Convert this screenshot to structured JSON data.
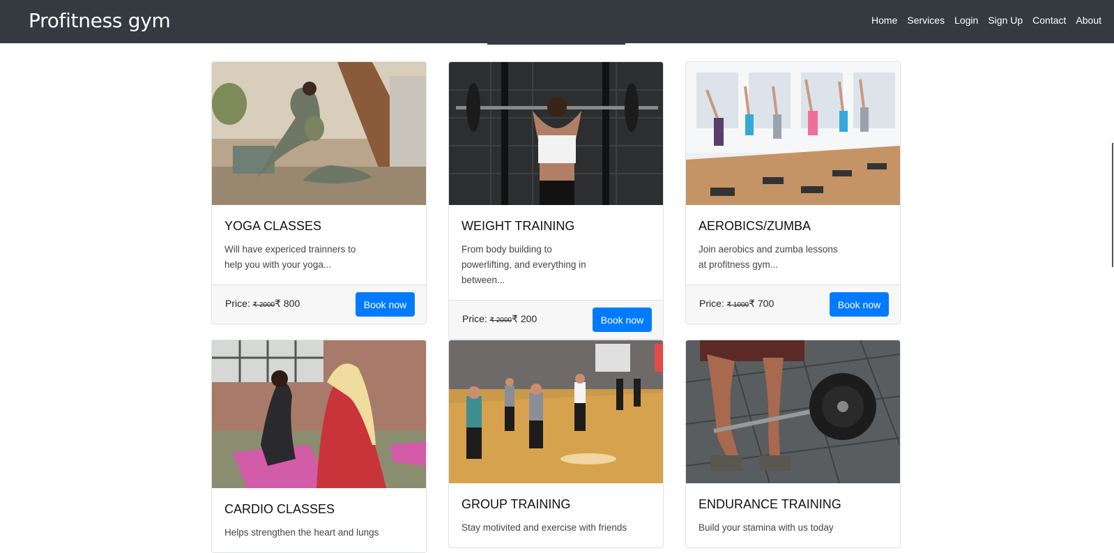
{
  "navbar": {
    "brand": "Profitness gym",
    "links": [
      "Home",
      "Services",
      "Login",
      "Sign Up",
      "Contact",
      "About"
    ]
  },
  "cards": [
    {
      "title": "YOGA CLASSES",
      "text": "Will have expericed trainners to help you with your yoga...",
      "price_label": "Price:",
      "old_price": "₹ 2000",
      "new_price": "₹ 800",
      "button": "Book now"
    },
    {
      "title": "WEIGHT TRAINING",
      "text": "From body building to powerlifting, and everything in between...",
      "price_label": "Price:",
      "old_price": "₹ 2000",
      "new_price": "₹ 200",
      "button": "Book now"
    },
    {
      "title": "AEROBICS/ZUMBA",
      "text": "Join aerobics and zumba lessons at profitness gym...",
      "price_label": "Price:",
      "old_price": "₹ 1000",
      "new_price": "₹ 700",
      "button": "Book now"
    },
    {
      "title": "CARDIO CLASSES",
      "text": "Helps strengthen the heart and lungs"
    },
    {
      "title": "GROUP TRAINING",
      "text": "Stay motivited and exercise with friends"
    },
    {
      "title": "ENDURANCE TRAINING",
      "text": "Build your stamina with us today"
    }
  ]
}
